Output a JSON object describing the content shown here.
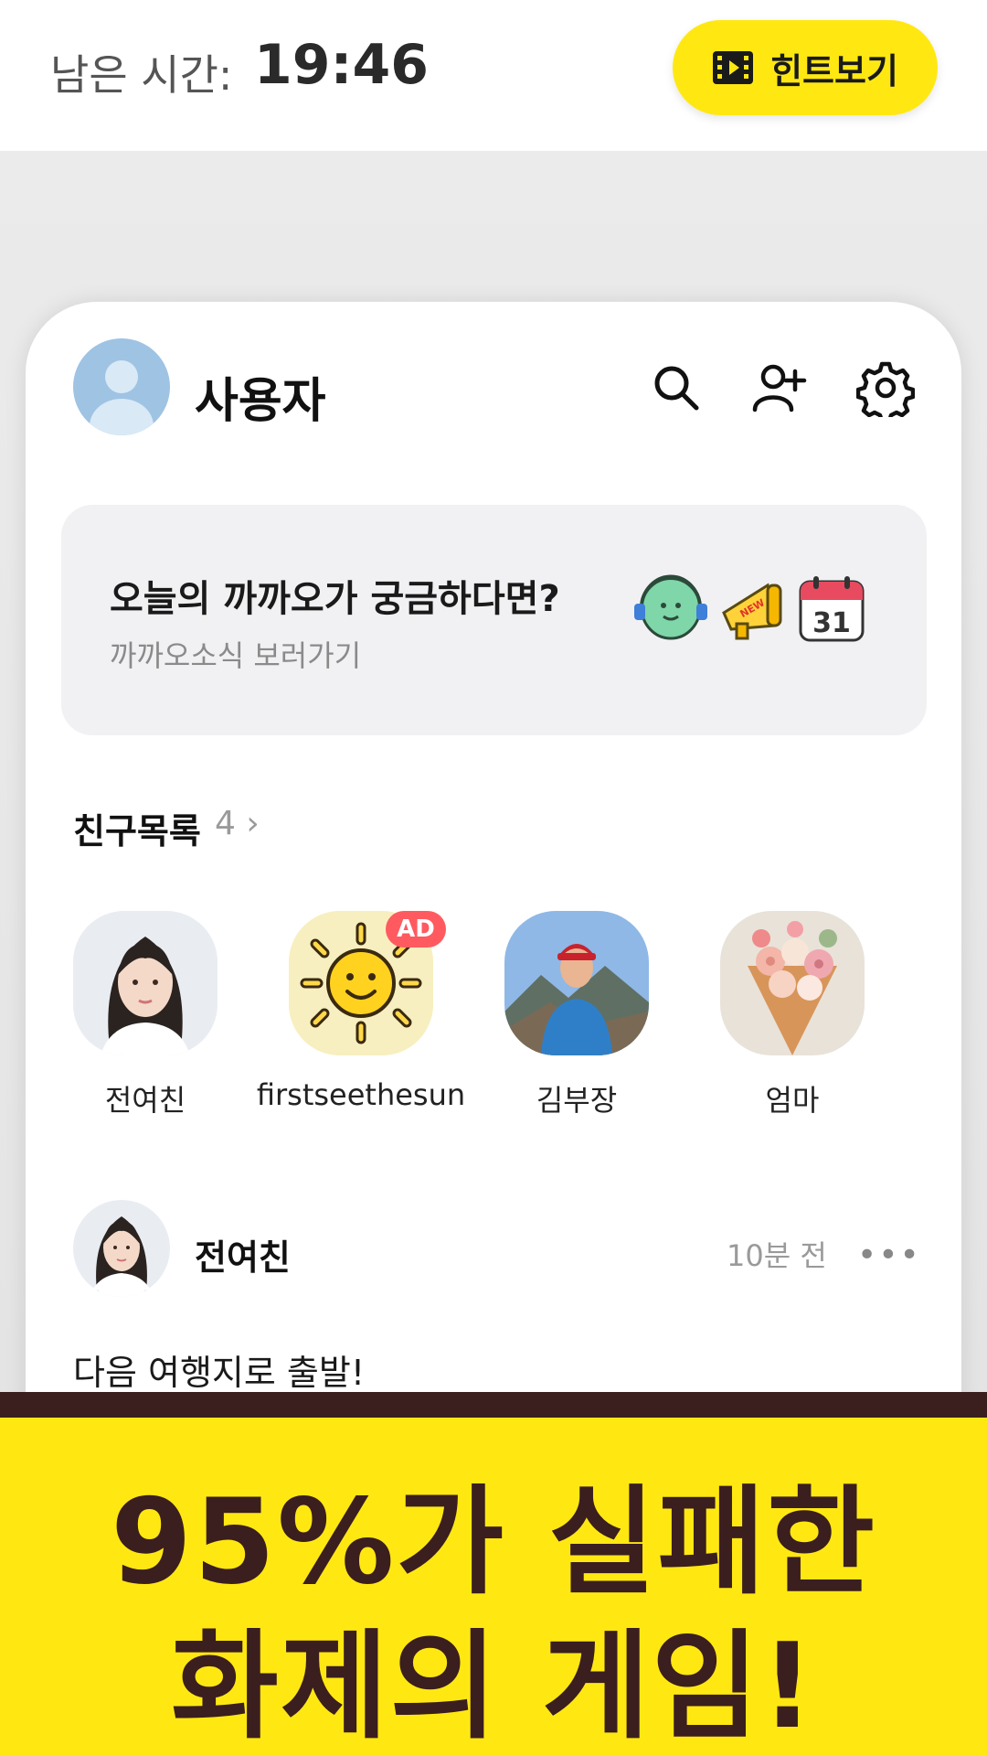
{
  "header": {
    "timer_label": "남은 시간:",
    "timer_value": "19:46",
    "hint_button_label": "힌트보기"
  },
  "profile": {
    "username": "사용자"
  },
  "banner": {
    "title": "오늘의 까까오가 궁금하다면?",
    "subtitle": "까까오소식 보러가기",
    "calendar_number": "31",
    "new_tag": "NEW"
  },
  "friends": {
    "title": "친구목록",
    "count": "4 ›",
    "items": [
      {
        "name": "전여친"
      },
      {
        "name": "firstseethesun",
        "badge": "AD"
      },
      {
        "name": "김부장"
      },
      {
        "name": "엄마"
      }
    ]
  },
  "post": {
    "author": "전여친",
    "time": "10분 전",
    "more": "•••",
    "text": "다음 여행지로 출발!"
  },
  "promo": {
    "line1": "95%가 실패한",
    "line2": "화제의 게임!"
  },
  "colors": {
    "brand_yellow": "#FFE812",
    "brand_brown": "#3B1E1E",
    "ad_red": "#FF5A5F"
  }
}
